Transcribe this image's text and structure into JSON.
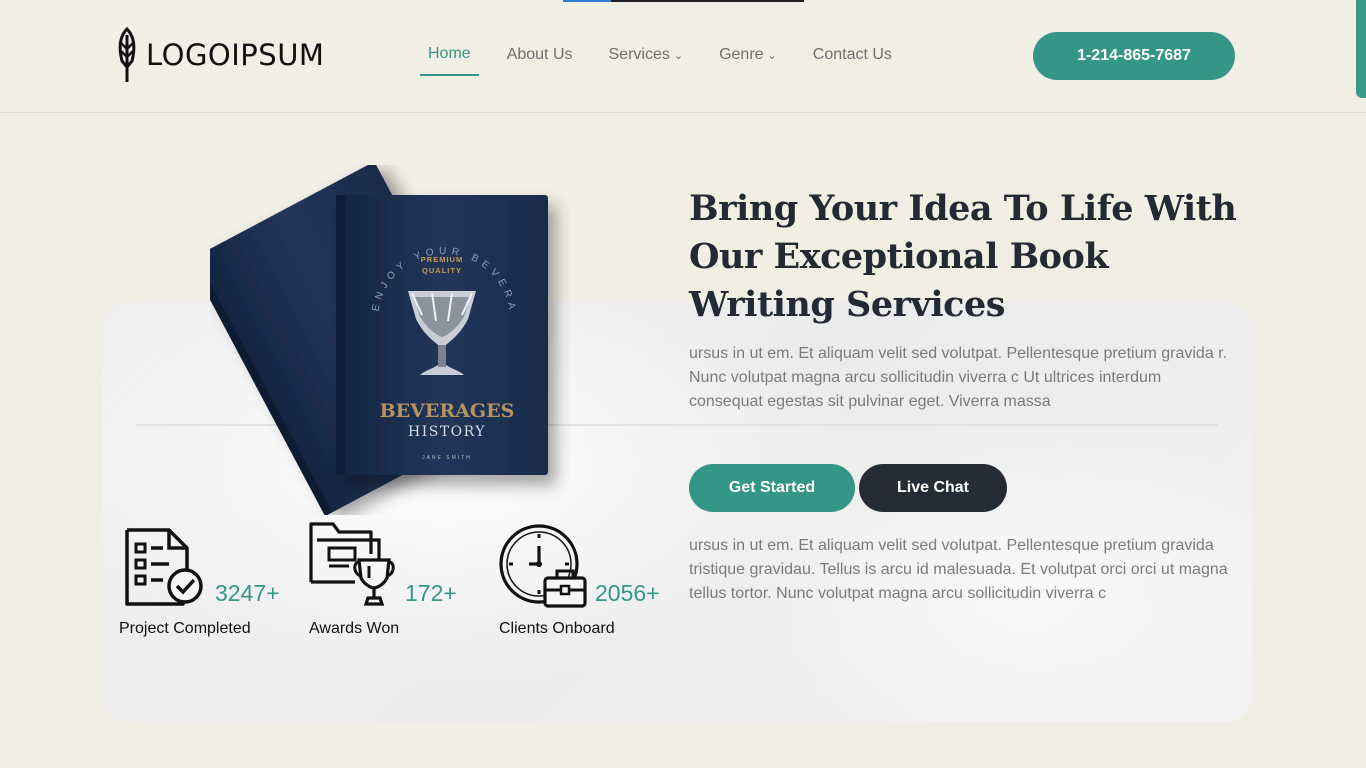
{
  "header": {
    "logo_text": "LOGOIPSUM",
    "nav": [
      {
        "label": "Home",
        "active": true,
        "dropdown": false
      },
      {
        "label": "About Us",
        "active": false,
        "dropdown": false
      },
      {
        "label": "Services",
        "active": false,
        "dropdown": true
      },
      {
        "label": "Genre",
        "active": false,
        "dropdown": true
      },
      {
        "label": "Contact Us",
        "active": false,
        "dropdown": false
      }
    ],
    "phone": "1-214-865-7687"
  },
  "book": {
    "arc_text": "ENJOY YOUR BEVERAGES",
    "badge": "PREMIUM QUALITY",
    "title_main": "BEVERAGES",
    "title_sub": "HISTORY",
    "author": "JANE SMITH"
  },
  "hero": {
    "headline": "Bring Your Idea To Life With Our Exceptional Book Writing Services",
    "para1": "ursus in ut em. Et aliquam velit sed volutpat. Pellentesque pretium gravida r. Nunc volutpat magna arcu sollicitudin viverra c Ut ultrices interdum consequat egestas sit pulvinar eget. Viverra massa",
    "get_started": "Get Started",
    "live_chat": "Live Chat",
    "para2": "ursus in ut em. Et aliquam velit sed volutpat. Pellentesque pretium gravida tristique gravidau. Tellus is arcu id malesuada. Et volutpat orci orci ut magna tellus tortor. Nunc volutpat magna arcu sollicitudin viverra c"
  },
  "stats": [
    {
      "number": "3247+",
      "label": "Project Completed",
      "icon": "checklist-icon"
    },
    {
      "number": "172+",
      "label": "Awards Won",
      "icon": "trophy-folder-icon"
    },
    {
      "number": "2056+",
      "label": "Clients Onboard",
      "icon": "clock-briefcase-icon"
    }
  ],
  "colors": {
    "accent": "#349687",
    "dark": "#262c33",
    "background": "#f1efe4",
    "book_cover": "#1f3152",
    "book_gold": "#b49460"
  }
}
